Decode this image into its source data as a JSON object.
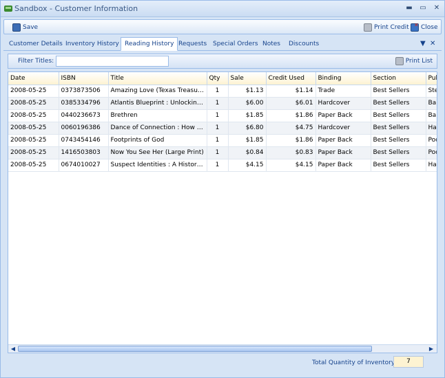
{
  "window": {
    "title": "Sandbox - Customer Information",
    "minimize": "▬",
    "maximize": "▭",
    "close": "✕"
  },
  "toolbar": {
    "save_label": "Save",
    "print_credit_label": "Print Credit",
    "close_label": "Close"
  },
  "tabs": [
    {
      "label": "Customer Details"
    },
    {
      "label": "Inventory  History"
    },
    {
      "label": "Reading History"
    },
    {
      "label": "Requests"
    },
    {
      "label": "Special Orders"
    },
    {
      "label": "Notes"
    },
    {
      "label": "Discounts"
    }
  ],
  "tab_controls": {
    "menu": "▼",
    "close": "✕"
  },
  "filter": {
    "label": "Filter Titles:",
    "value": "",
    "print_list_label": "Print List"
  },
  "grid": {
    "columns": [
      "Date",
      "ISBN",
      "Title",
      "Qty",
      "Sale",
      "Credit Used",
      "Binding",
      "Section",
      "Pub"
    ],
    "rows": [
      [
        "2008-05-25",
        "0373873506",
        "Amazing Love (Texas Treasures ...",
        "1",
        "$1.13",
        "$1.14",
        "Trade",
        "Best Sellers",
        "Ste"
      ],
      [
        "2008-05-25",
        "0385334796",
        "Atlantis Blueprint : Unlocking t...",
        "1",
        "$6.00",
        "$6.01",
        "Hardcover",
        "Best Sellers",
        "Bar"
      ],
      [
        "2008-05-25",
        "0440236673",
        "Brethren",
        "1",
        "$1.85",
        "$1.86",
        "Paper Back",
        "Best Sellers",
        "Bar"
      ],
      [
        "2008-05-25",
        "0060196386",
        "Dance of Connection : How to ...",
        "1",
        "$6.80",
        "$4.75",
        "Hardcover",
        "Best Sellers",
        "Ha"
      ],
      [
        "2008-05-25",
        "0743454146",
        "Footprints of God",
        "1",
        "$1.85",
        "$1.86",
        "Paper Back",
        "Best Sellers",
        "Poc"
      ],
      [
        "2008-05-25",
        "1416503803",
        "Now You See Her (Large Print)",
        "1",
        "$0.84",
        "$0.83",
        "Paper Back",
        "Best Sellers",
        "Poc"
      ],
      [
        "2008-05-25",
        "0674010027",
        "Suspect Identities : A History o...",
        "1",
        "$4.15",
        "$4.15",
        "Paper Back",
        "Best Sellers",
        "Ha"
      ]
    ],
    "scroll_left": "◀",
    "scroll_right": "▶"
  },
  "footer": {
    "total_label": "Total Quantity of Inventory:",
    "total_value": "7"
  }
}
